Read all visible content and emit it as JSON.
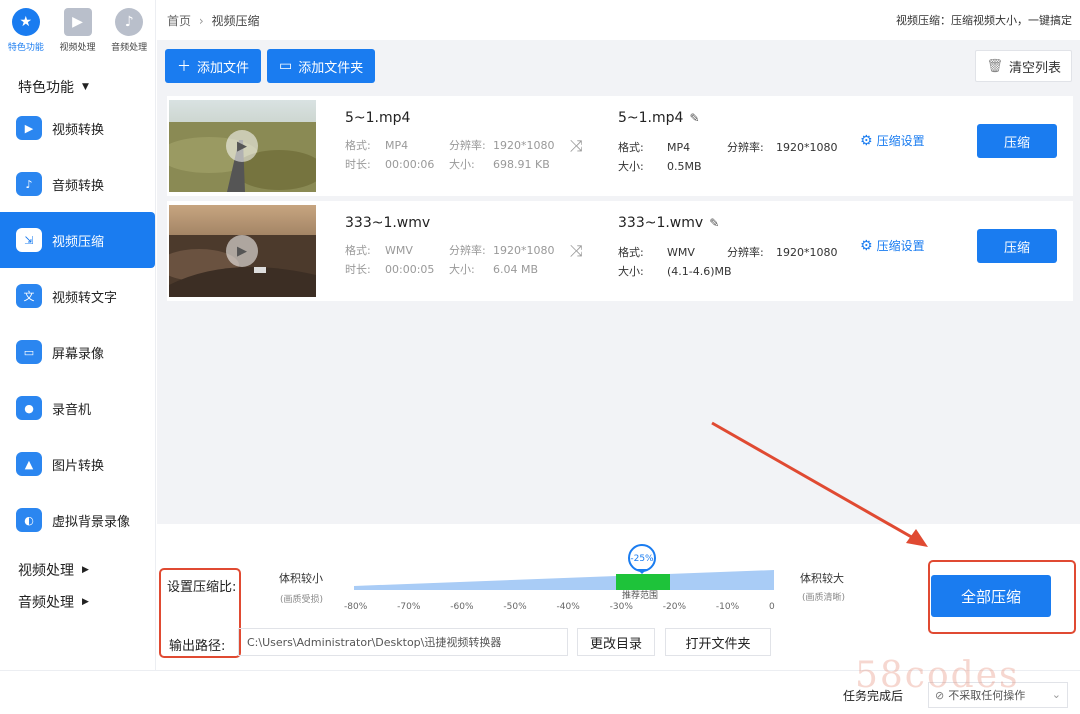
{
  "sidebar": {
    "top_tabs": [
      {
        "label": "特色功能",
        "icon": "star-icon",
        "color": "#1a7cf0"
      },
      {
        "label": "视频处理",
        "icon": "video-icon",
        "color": "#8e96a6"
      },
      {
        "label": "音频处理",
        "icon": "audio-icon",
        "color": "#8e96a6"
      }
    ],
    "section_feature": "特色功能",
    "items": [
      {
        "label": "视频转换",
        "icon": "video-convert-icon",
        "color": "#2b86f0"
      },
      {
        "label": "音频转换",
        "icon": "audio-convert-icon",
        "color": "#2b86f0"
      },
      {
        "label": "视频压缩",
        "icon": "video-compress-icon",
        "color": "#2b86f0"
      },
      {
        "label": "视频转文字",
        "icon": "video-to-text-icon",
        "color": "#2b86f0"
      },
      {
        "label": "屏幕录像",
        "icon": "screen-record-icon",
        "color": "#2b86f0"
      },
      {
        "label": "录音机",
        "icon": "recorder-icon",
        "color": "#2b86f0"
      },
      {
        "label": "图片转换",
        "icon": "image-convert-icon",
        "color": "#2b86f0"
      },
      {
        "label": "虚拟背景录像",
        "icon": "virtual-bg-icon",
        "color": "#2b86f0"
      }
    ],
    "section_video": "视频处理",
    "section_audio": "音频处理"
  },
  "header": {
    "breadcrumb_home": "首页",
    "breadcrumb_current": "视频压缩",
    "description": "视频压缩：压缩视频大小，一键搞定"
  },
  "toolbar": {
    "add_file": "添加文件",
    "add_folder": "添加文件夹",
    "clear_list": "清空列表"
  },
  "files": [
    {
      "name": "5~1.mp4",
      "format_label": "格式:",
      "format": "MP4",
      "res_label": "分辨率:",
      "resolution": "1920*1080",
      "dur_label": "时长:",
      "duration": "00:00:06",
      "size_label": "大小:",
      "size": "698.91 KB",
      "out_name": "5~1.mp4",
      "out_format": "MP4",
      "out_resolution": "1920*1080",
      "out_size": "0.5MB",
      "settings": "压缩设置",
      "compress": "压缩"
    },
    {
      "name": "333~1.wmv",
      "format_label": "格式:",
      "format": "WMV",
      "res_label": "分辨率:",
      "resolution": "1920*1080",
      "dur_label": "时长:",
      "duration": "00:00:05",
      "size_label": "大小:",
      "size": "6.04 MB",
      "out_name": "333~1.wmv",
      "out_format": "WMV",
      "out_resolution": "1920*1080",
      "out_size": "(4.1-4.6)MB",
      "settings": "压缩设置",
      "compress": "压缩"
    }
  ],
  "compress_panel": {
    "ratio_label": "设置压缩比:",
    "smaller": "体积较小",
    "smaller_sub": "(画质受损)",
    "larger": "体积较大",
    "larger_sub": "(画质清晰)",
    "recommended": "推荐范围",
    "current_value": "-25%",
    "current_percent": -25,
    "ticks": [
      "-80%",
      "-70%",
      "-60%",
      "-50%",
      "-40%",
      "-30%",
      "-20%",
      "-10%",
      "0"
    ],
    "output_label": "输出路径:",
    "output_path": "C:\\Users\\Administrator\\Desktop\\迅捷视频转换器",
    "change_dir": "更改目录",
    "open_folder": "打开文件夹",
    "compress_all": "全部压缩"
  },
  "status_bar": {
    "after_task_label": "任务完成后",
    "after_task_value": "不采取任何操作"
  },
  "watermark": "58codes"
}
